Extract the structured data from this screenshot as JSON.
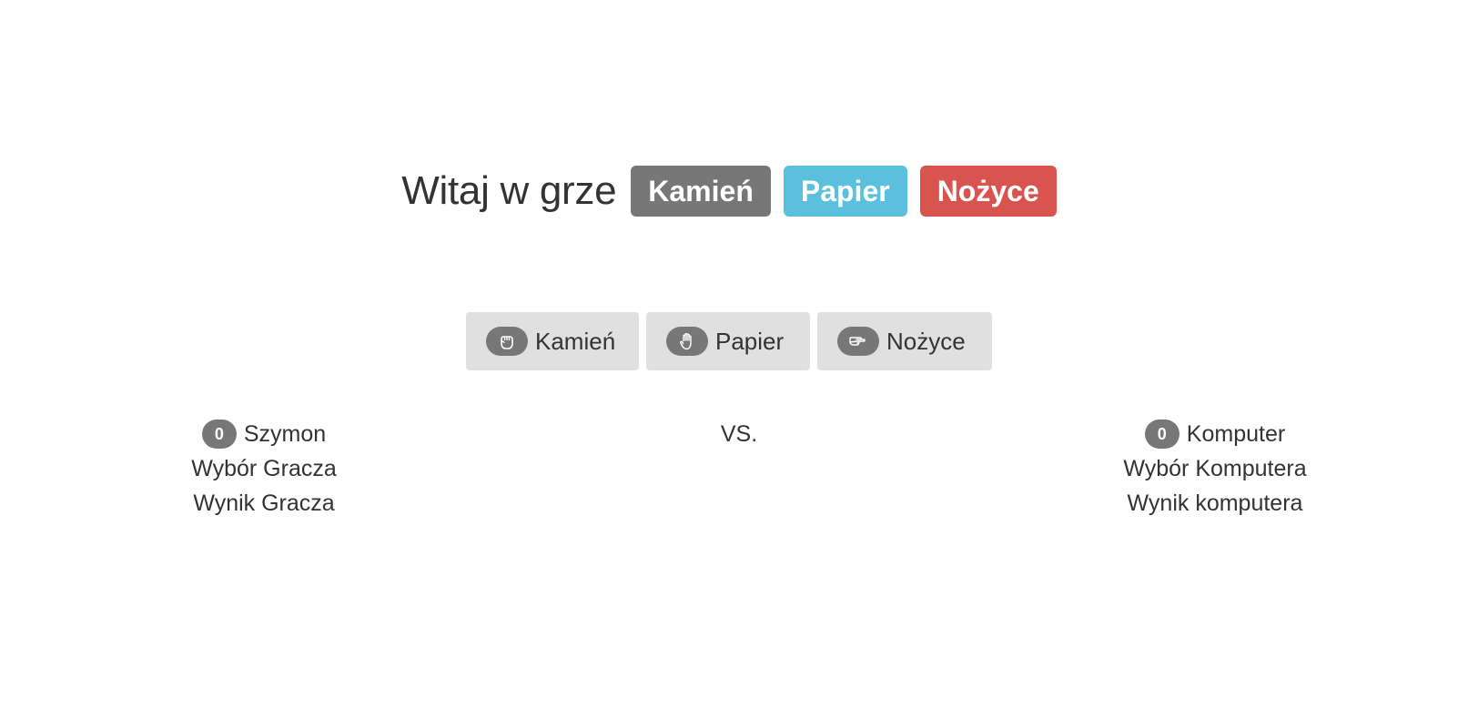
{
  "header": {
    "title": "Witaj w grze",
    "labels": {
      "rock": "Kamień",
      "paper": "Papier",
      "scissors": "Nożyce"
    }
  },
  "choices": [
    {
      "label": "Kamień",
      "icon": "fist-icon"
    },
    {
      "label": "Papier",
      "icon": "open-hand-icon"
    },
    {
      "label": "Nożyce",
      "icon": "scissors-hand-icon"
    }
  ],
  "player": {
    "score": "0",
    "name": "Szymon",
    "choice_label": "Wybór Gracza",
    "result_label": "Wynik Gracza"
  },
  "versus": "VS.",
  "computer": {
    "score": "0",
    "name": "Komputer",
    "choice_label": "Wybór Komputera",
    "result_label": "Wynik komputera"
  },
  "colors": {
    "default": "#777777",
    "info": "#5bc0de",
    "danger": "#d9534f",
    "button_bg": "#e0e0e0",
    "text": "#333333"
  }
}
